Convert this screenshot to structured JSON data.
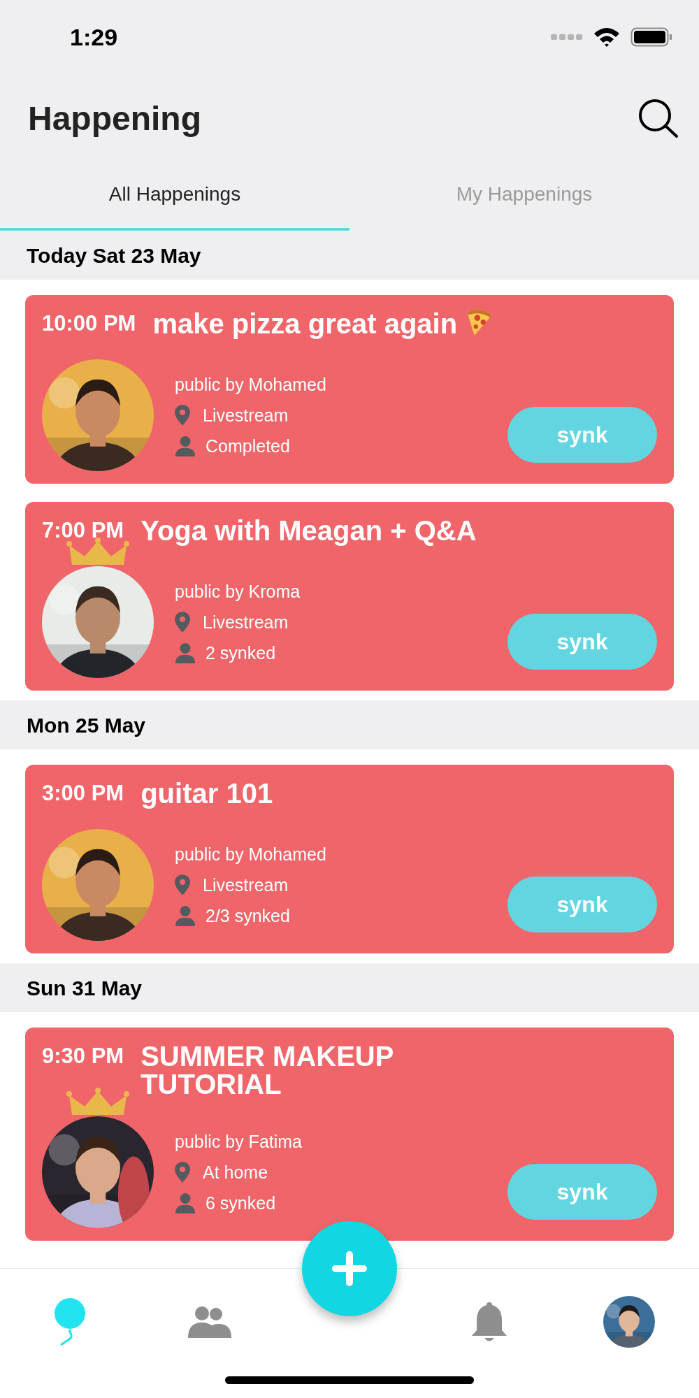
{
  "status_bar": {
    "time": "1:29"
  },
  "header": {
    "title": "Happening"
  },
  "tabs": [
    {
      "label": "All Happenings",
      "selected": true
    },
    {
      "label": "My Happenings",
      "selected": false
    }
  ],
  "sections": [
    {
      "date": "Today Sat 23 May",
      "events": [
        {
          "time": "10:00 PM",
          "title": "make pizza great again",
          "pizza_icon": true,
          "crowned": false,
          "host": "public by Mohamed",
          "location": "Livestream",
          "attendance": "Completed",
          "button": "synk"
        },
        {
          "time": "7:00 PM",
          "title": "Yoga with Meagan + Q&A",
          "pizza_icon": false,
          "crowned": true,
          "host": "public by Kroma",
          "location": "Livestream",
          "attendance": "2 synked",
          "button": "synk"
        }
      ]
    },
    {
      "date": "Mon 25 May",
      "events": [
        {
          "time": "3:00 PM",
          "title": "guitar 101",
          "pizza_icon": false,
          "crowned": false,
          "host": "public by Mohamed",
          "location": "Livestream",
          "attendance": "2/3 synked",
          "button": "synk"
        }
      ]
    },
    {
      "date": "Sun 31 May",
      "events": [
        {
          "time": "9:30 PM",
          "title": "SUMMER MAKEUP TUTORIAL",
          "pizza_icon": false,
          "crowned": true,
          "host": "public by Fatima",
          "location": "At home",
          "attendance": "6 synked",
          "button": "synk"
        }
      ]
    }
  ],
  "nav": [
    {
      "kind": "balloon",
      "selected": true
    },
    {
      "kind": "people",
      "selected": false
    },
    {
      "kind": "add",
      "selected": false
    },
    {
      "kind": "bell",
      "selected": false
    },
    {
      "kind": "profile",
      "selected": false
    }
  ]
}
